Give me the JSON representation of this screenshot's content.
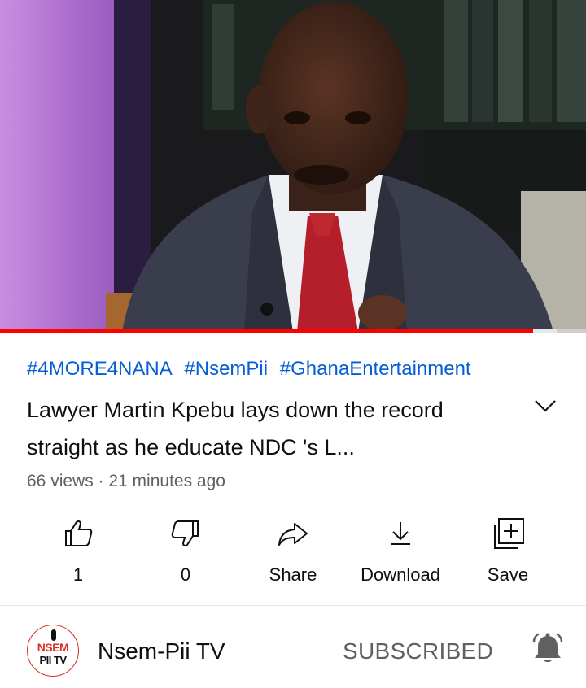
{
  "video": {
    "progress_fraction": 0.91,
    "buffered_fraction": 0.04
  },
  "hashtags": [
    "#4MORE4NANA",
    "#NsemPii",
    "#GhanaEntertainment"
  ],
  "title": "Lawyer Martin Kpebu lays down the record straight as he educate NDC 's L...",
  "meta": "66 views · 21 minutes ago",
  "actions": {
    "like": "1",
    "dislike": "0",
    "share": "Share",
    "download": "Download",
    "save": "Save"
  },
  "channel": {
    "name": "Nsem-Pii TV",
    "avatar_text_top": "NSEM",
    "avatar_text_bottom": "PII TV",
    "subscribe_label": "SUBSCRIBED"
  },
  "colors": {
    "link": "#065fd4",
    "progress": "#ff0000",
    "secondary_text": "#606060"
  },
  "icons": [
    "thumb-up-icon",
    "thumb-down-icon",
    "share-icon",
    "download-icon",
    "save-playlist-icon",
    "chevron-down-icon",
    "bell-icon"
  ]
}
